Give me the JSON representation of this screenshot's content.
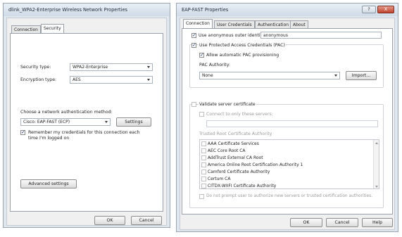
{
  "left_window": {
    "title": "dlink_WPA2-Enterprise Wireless Network Properties",
    "tabs": [
      "Connection",
      "Security"
    ],
    "security_type_label": "Security type:",
    "security_type_value": "WPA2-Enterprise",
    "encryption_type_label": "Encryption type:",
    "encryption_type_value": "AES",
    "auth_method_label": "Choose a network authentication method:",
    "auth_method_value": "Cisco: EAP-FAST (ECP)",
    "settings_button": "Settings",
    "remember_credentials_line1": "Remember my credentials for this connection each",
    "remember_credentials_line2": "time I'm logged on",
    "remember_credentials_checked": true,
    "advanced_settings_button": "Advanced settings",
    "ok_button": "OK",
    "cancel_button": "Cancel"
  },
  "right_window": {
    "title": "EAP-FAST Properties",
    "help_glyph": "?",
    "close_glyph": "X",
    "tabs": [
      "Connection",
      "User Credentials",
      "Authentication",
      "About"
    ],
    "use_anonymous_label": "Use anonymous outer identity",
    "use_anonymous_checked": true,
    "anonymous_value": "anonymous",
    "use_pac_label": "Use Protected Access Credentials (PAC)",
    "use_pac_checked": true,
    "allow_auto_pac_label": "Allow automatic PAC provisioning",
    "allow_auto_pac_checked": true,
    "pac_authority_label": "PAC Authority:",
    "pac_authority_value": "None",
    "import_button": "Import...",
    "validate_cert_label": "Validate server certificate",
    "validate_cert_checked": false,
    "connect_only_label": "Connect to only these servers:",
    "trusted_root_label": "Trusted Root Certificate Authority",
    "cert_list": [
      "AAA Certificate Services",
      "AEC Core Root CA",
      "AddTrust External CA Root",
      "America Online Root Certification Authority 1",
      "Camford Certificate Authority",
      "Certum CA",
      "CITDX-WIIFI Certificate Authority"
    ],
    "do_not_prompt_label": "Do not prompt user to authorize new servers or trusted certification authorities.",
    "ok_button": "OK",
    "cancel_button": "Cancel",
    "help_button": "Help"
  }
}
